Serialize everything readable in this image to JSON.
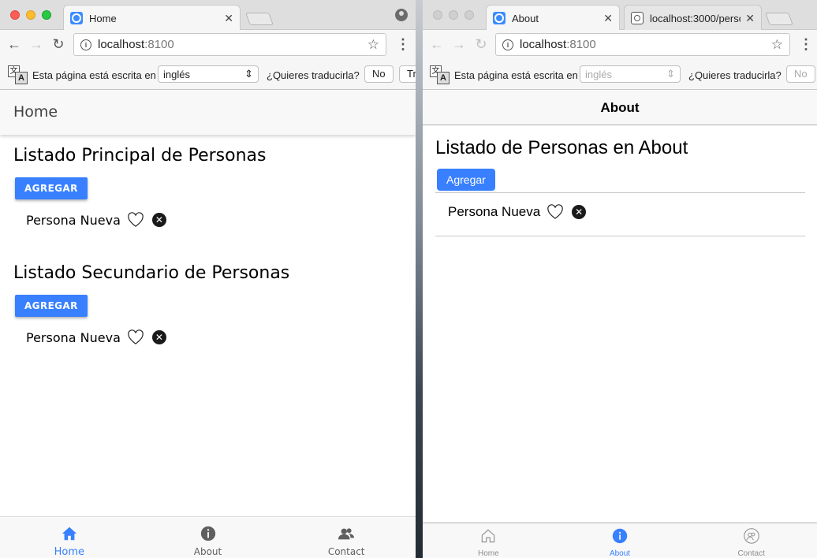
{
  "left_window": {
    "tab": {
      "title": "Home"
    },
    "address": {
      "host": "localhost",
      "port": ":8100"
    },
    "translate_bar": {
      "message": "Esta página está escrita en",
      "language": "inglés",
      "question": "¿Quieres traducirla?",
      "no_label": "No",
      "translate_label": "Tr"
    },
    "app": {
      "header_title": "Home",
      "sections": [
        {
          "title": "Listado Principal de Personas",
          "add_label": "AGREGAR",
          "person": "Persona Nueva"
        },
        {
          "title": "Listado Secundario de Personas",
          "add_label": "AGREGAR",
          "person": "Persona Nueva"
        }
      ],
      "tabs": [
        {
          "label": "Home",
          "icon": "home-icon",
          "active": true
        },
        {
          "label": "About",
          "icon": "info-icon",
          "active": false
        },
        {
          "label": "Contact",
          "icon": "contacts-icon",
          "active": false
        }
      ]
    }
  },
  "right_window": {
    "tabs": [
      {
        "title": "About"
      },
      {
        "title": "localhost:3000/perso"
      }
    ],
    "address": {
      "host": "localhost",
      "port": ":8100"
    },
    "translate_bar": {
      "message": "Esta página está escrita en",
      "language": "inglés",
      "question": "¿Quieres traducirla?",
      "no_label": "No"
    },
    "app": {
      "header_title": "About",
      "list_title": "Listado de Personas en About",
      "add_label": "Agregar",
      "person": "Persona Nueva",
      "tabs": [
        {
          "label": "Home",
          "icon": "home-outline-icon",
          "active": false
        },
        {
          "label": "About",
          "icon": "info-icon",
          "active": true
        },
        {
          "label": "Contact",
          "icon": "contacts-outline-icon",
          "active": false
        }
      ]
    }
  },
  "colors": {
    "primary": "#3880ff",
    "tab_inactive": "#5f5f5f"
  }
}
